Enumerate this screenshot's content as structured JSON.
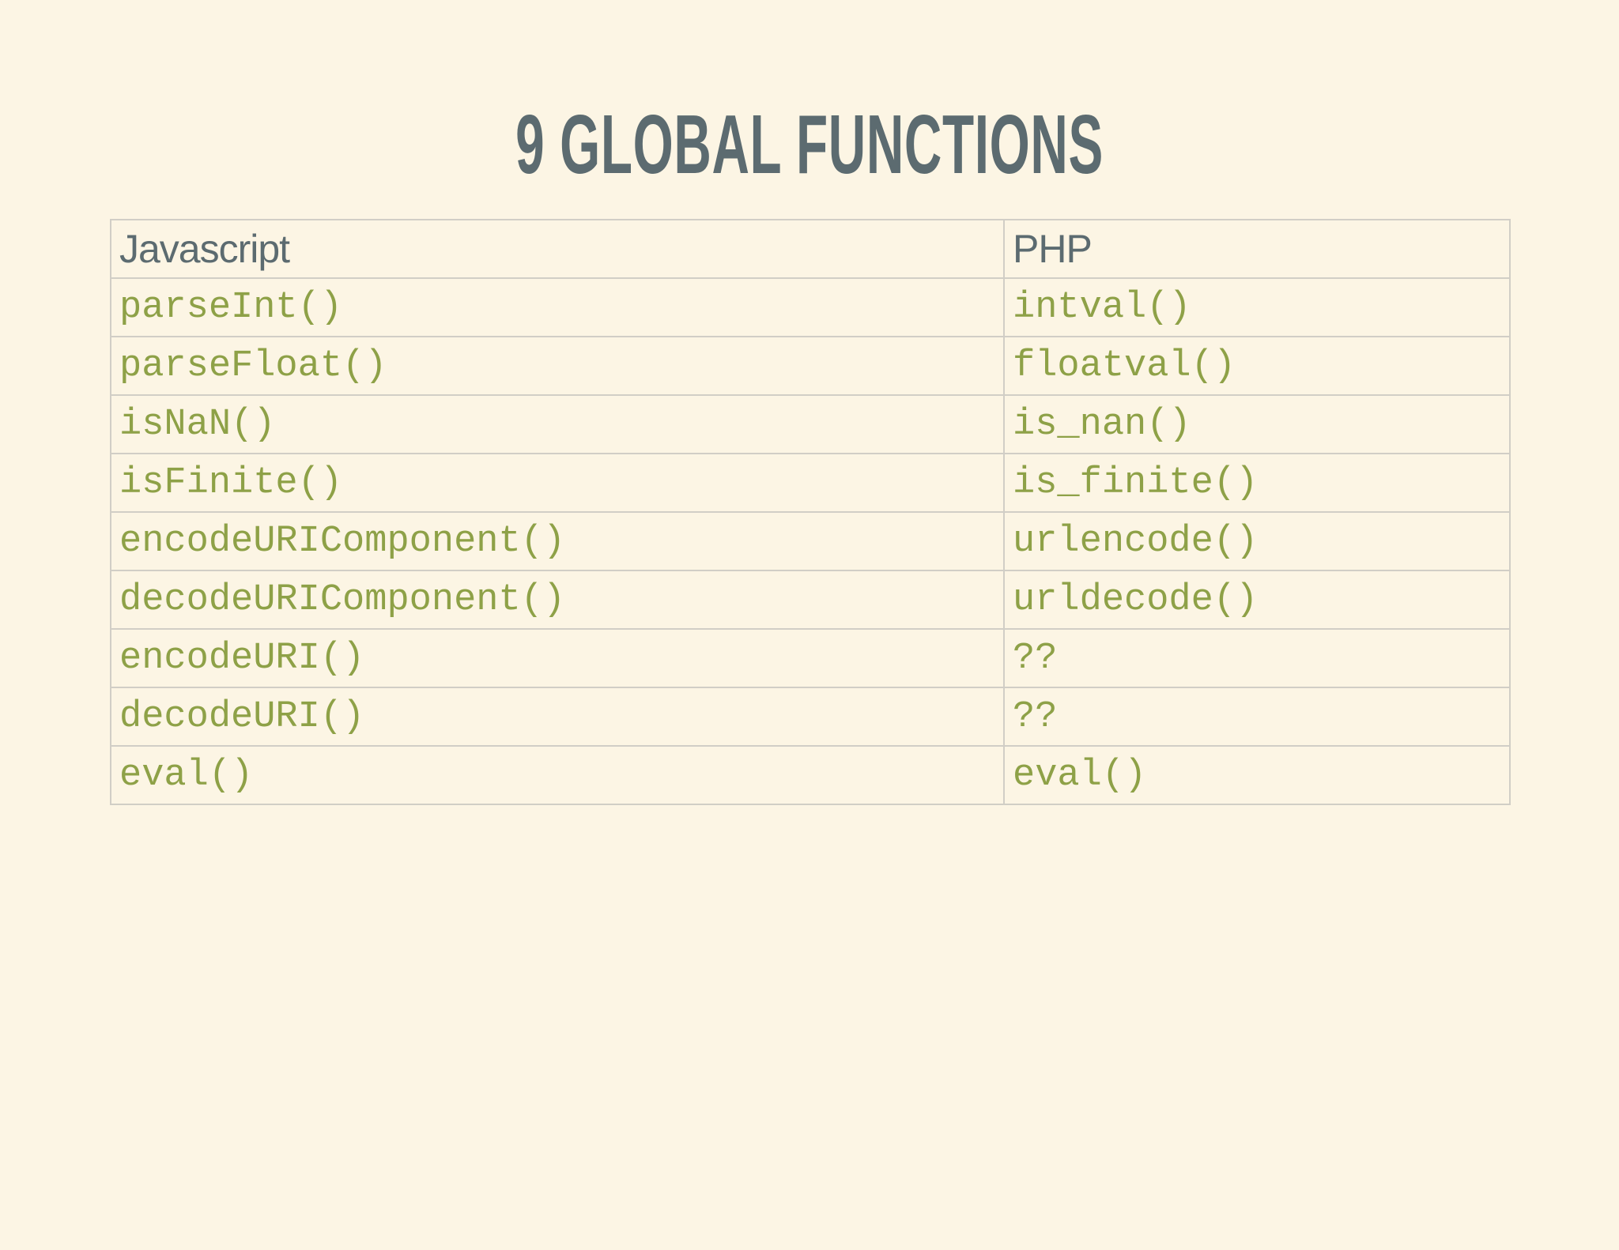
{
  "title": "9 GLOBAL FUNCTIONS",
  "table": {
    "headers": [
      "Javascript",
      "PHP"
    ],
    "rows": [
      [
        "parseInt()",
        "intval()"
      ],
      [
        "parseFloat()",
        "floatval()"
      ],
      [
        "isNaN()",
        "is_nan()"
      ],
      [
        "isFinite()",
        "is_finite()"
      ],
      [
        "encodeURIComponent()",
        "urlencode()"
      ],
      [
        "decodeURIComponent()",
        "urldecode()"
      ],
      [
        "encodeURI()",
        "??"
      ],
      [
        "decodeURI()",
        "??"
      ],
      [
        "eval()",
        "eval()"
      ]
    ]
  },
  "colors": {
    "background": "#fcf5e4",
    "title": "#5c6b70",
    "header_text": "#5c6b70",
    "code_text": "#8ea147",
    "grid": "#d1cec6"
  }
}
